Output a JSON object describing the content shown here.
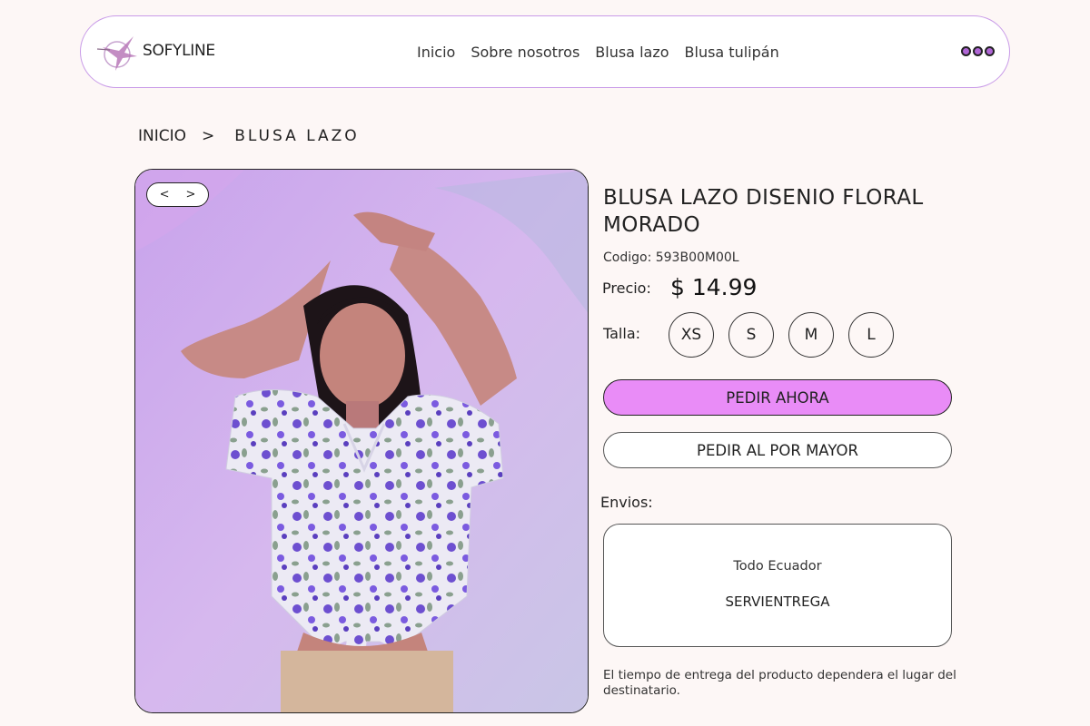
{
  "header": {
    "brand": "SOFYLINE",
    "nav": [
      "Inicio",
      "Sobre nosotros",
      "Blusa lazo",
      "Blusa tulipán"
    ]
  },
  "breadcrumb": {
    "home": "INICIO",
    "separator": ">",
    "current": "BLUSA LAZO"
  },
  "gallery": {
    "prev": "<",
    "next": ">"
  },
  "product": {
    "title": "BLUSA LAZO DISENIO FLORAL MORADO",
    "code": "Codigo: 593B00M00L",
    "price_label": "Precio:",
    "price": "$ 14.99",
    "size_label": "Talla:",
    "sizes": [
      "XS",
      "S",
      "M",
      "L"
    ]
  },
  "actions": {
    "order_now": "PEDIR AHORA",
    "order_wholesale": "PEDIR AL POR MAYOR"
  },
  "shipping": {
    "label": "Envios:",
    "coverage": "Todo Ecuador",
    "carrier": "SERVIENTREGA",
    "note": "El tiempo de entrega del producto dependera el lugar del destinatario."
  },
  "colors": {
    "accent": "#e98cf7",
    "header_border": "#c99be8",
    "background": "#fdf7f6"
  }
}
